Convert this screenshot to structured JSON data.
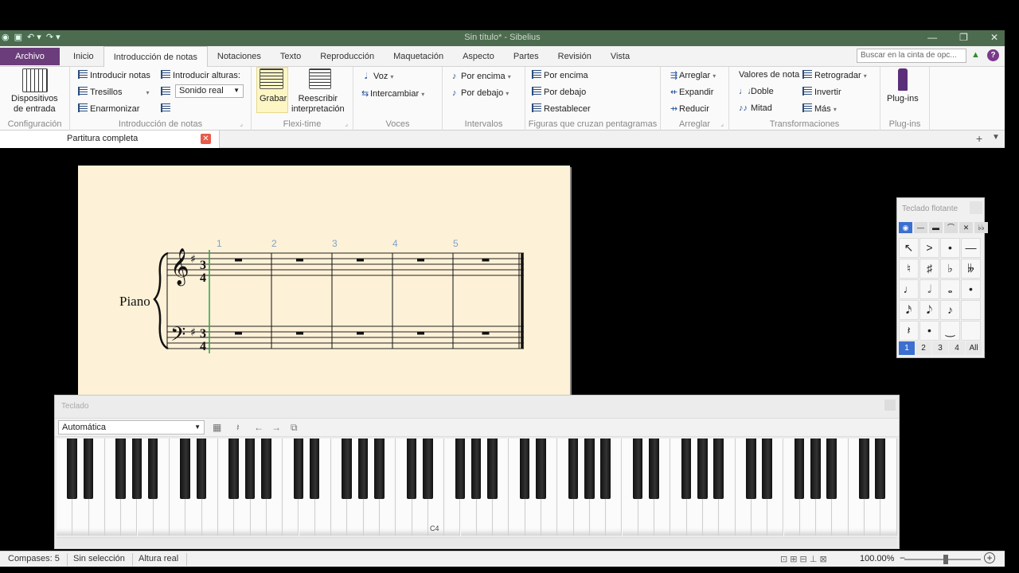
{
  "window": {
    "title": "Sin título* - Sibelius"
  },
  "tabs": {
    "archivo": "Archivo",
    "items": [
      "Inicio",
      "Introducción de notas",
      "Notaciones",
      "Texto",
      "Reproducción",
      "Maquetación",
      "Aspecto",
      "Partes",
      "Revisión",
      "Vista"
    ],
    "active_index": 1,
    "search_placeholder": "Buscar en la cinta de opc..."
  },
  "ribbon": {
    "config": {
      "button": "Dispositivos\nde entrada",
      "group": "Configuración"
    },
    "note_input": {
      "introducir_notas": "Introducir notas",
      "tresillos": "Tresillos",
      "enarmonizar": "Enarmonizar",
      "introducir_alturas": "Introducir alturas:",
      "sonido_select": "Sonido real",
      "group": "Introducción de notas"
    },
    "flexi": {
      "grabar": "Grabar",
      "reescribir": "Reescribir\ninterpretación",
      "group": "Flexi-time"
    },
    "voices": {
      "voz": "Voz",
      "intercambiar": "Intercambiar",
      "group": "Voces"
    },
    "intervals": {
      "encima": "Por encima",
      "debajo": "Por debajo",
      "group": "Intervalos"
    },
    "cross": {
      "encima": "Por encima",
      "debajo": "Por debajo",
      "restablecer": "Restablecer",
      "group": "Figuras que cruzan pentagramas"
    },
    "arrange": {
      "arreglar": "Arreglar",
      "expandir": "Expandir",
      "reducir": "Reducir",
      "group": "Arreglar"
    },
    "transform": {
      "valores": "Valores de nota",
      "retrogradar": "Retrogradar",
      "doble": "Doble",
      "invertir": "Invertir",
      "mitad": "Mitad",
      "mas": "Más",
      "group": "Transformaciones"
    },
    "plugins": {
      "button": "Plug-ins",
      "group": "Plug-ins"
    }
  },
  "doc_tab": {
    "label": "Partitura completa"
  },
  "score": {
    "instrument": "Piano",
    "bar_numbers": [
      "1",
      "2",
      "3",
      "4",
      "5"
    ],
    "time_signature": "3/4",
    "key": "1 sharp"
  },
  "keypad": {
    "title": "Teclado flotante",
    "layers": [
      "1",
      "2",
      "3",
      "4",
      "All"
    ],
    "keys": [
      "↖",
      ">",
      "•",
      "—",
      "♮",
      "♯",
      "♭",
      "𝄫",
      "♩",
      "𝅗𝅥",
      "𝅝",
      "•",
      "𝅘𝅥𝅯",
      "𝅘𝅥𝅮",
      "♪",
      "",
      "𝄽",
      "•",
      "‿",
      ""
    ]
  },
  "keyboard_window": {
    "title": "Teclado",
    "mode": "Automática",
    "middle_c": "C4"
  },
  "status": {
    "compases": "Compases: 5",
    "seleccion": "Sin selección",
    "altura": "Altura real",
    "zoom": "100.00%"
  }
}
